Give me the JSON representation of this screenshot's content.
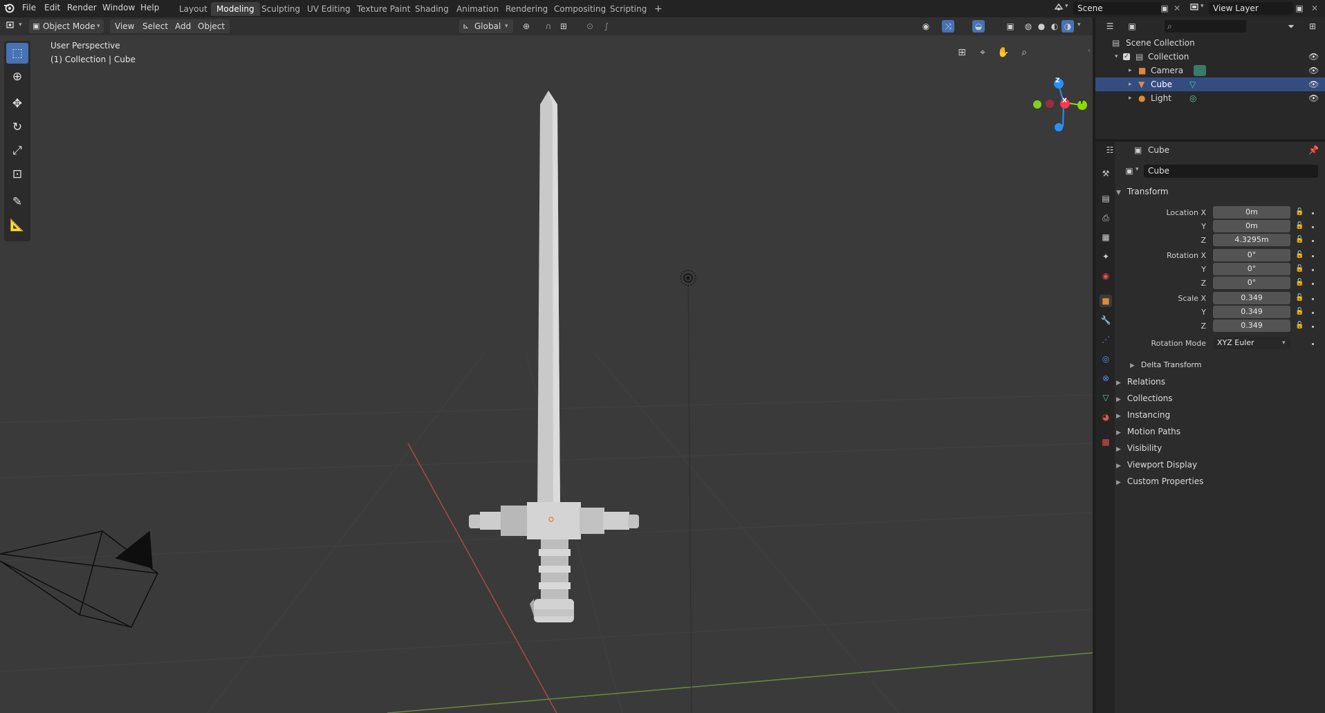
{
  "top_bar": {
    "menus": [
      "File",
      "Edit",
      "Render",
      "Window",
      "Help"
    ],
    "workspaces": [
      "Layout",
      "Modeling",
      "Sculpting",
      "UV Editing",
      "Texture Paint",
      "Shading",
      "Animation",
      "Rendering",
      "Compositing",
      "Scripting"
    ],
    "active_workspace": "Modeling",
    "add_workspace": "+",
    "scene_name": "Scene",
    "view_layer_name": "View Layer"
  },
  "viewport_header": {
    "mode": "Object Mode",
    "menus": [
      "View",
      "Select",
      "Add",
      "Object"
    ],
    "transform_orientation": "Global"
  },
  "viewport": {
    "perspective_label": "User Perspective",
    "collection_label": "(1) Collection | Cube",
    "gizmo": {
      "z": "Z",
      "x": "X",
      "y": "Y"
    }
  },
  "outliner": {
    "scene_collection": "Scene Collection",
    "collection": "Collection",
    "items": [
      {
        "name": "Camera",
        "selected": false,
        "color": "#e08b3a"
      },
      {
        "name": "Cube",
        "selected": true,
        "color": "#e08b3a"
      },
      {
        "name": "Light",
        "selected": false,
        "color": "#e08b3a"
      }
    ]
  },
  "properties": {
    "header_object": "Cube",
    "object_name": "Cube",
    "transform_title": "Transform",
    "location": {
      "label": "Location X",
      "x": "0m",
      "y": "0m",
      "z": "4.3295m"
    },
    "rotation": {
      "label": "Rotation X",
      "x": "0°",
      "y": "0°",
      "z": "0°"
    },
    "scale": {
      "label": "Scale X",
      "x": "0.349",
      "y": "0.349",
      "z": "0.349"
    },
    "axis_y": "Y",
    "axis_z": "Z",
    "rotation_mode_label": "Rotation Mode",
    "rotation_mode_value": "XYZ Euler",
    "delta_transform": "Delta Transform",
    "panels": [
      "Relations",
      "Collections",
      "Instancing",
      "Motion Paths",
      "Visibility",
      "Viewport Display",
      "Custom Properties"
    ]
  },
  "colors": {
    "accent": "#4772b3",
    "selected_row": "#334d80",
    "x_axis": "#ff3352",
    "y_axis": "#8bdc00",
    "z_axis": "#2890ff"
  }
}
